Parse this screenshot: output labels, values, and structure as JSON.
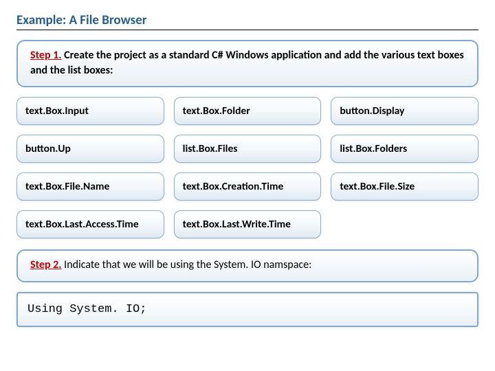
{
  "title": "Example: A File Browser",
  "step1": {
    "label": "Step 1.",
    "text": " Create the project as a standard C# Windows application and add the various text boxes and the list boxes:"
  },
  "controls": [
    "text.Box.Input",
    "text.Box.Folder",
    "button.Display",
    "button.Up",
    "list.Box.Files",
    "list.Box.Folders",
    "text.Box.File.Name",
    "text.Box.Creation.Time",
    "text.Box.File.Size",
    "text.Box.Last.Access.Time",
    "text.Box.Last.Write.Time"
  ],
  "step2": {
    "label": "Step 2.",
    "text": " Indicate that we will be using the System. IO namspace:"
  },
  "code": "Using System. IO;"
}
